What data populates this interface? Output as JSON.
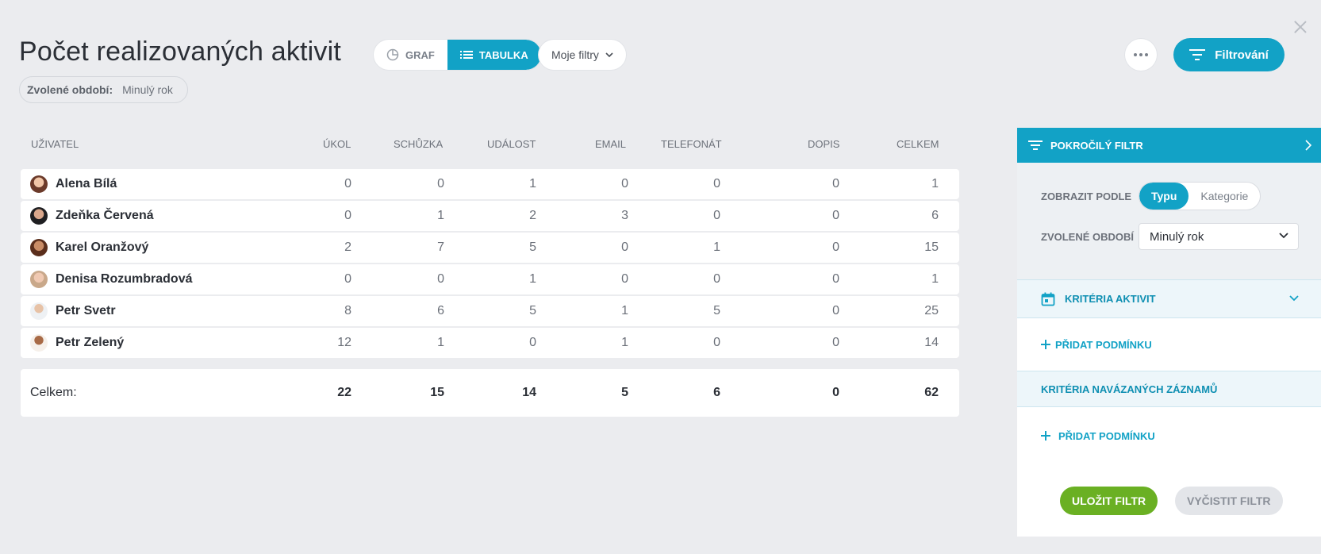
{
  "header": {
    "title": "Počet realizovaných aktivit",
    "view_graph_label": "GRAF",
    "view_table_label": "TABULKA",
    "my_filters_label": "Moje filtry",
    "period_key": "Zvolené období:",
    "period_value": "Minulý rok",
    "filter_button_label": "Filtrování"
  },
  "table": {
    "columns": [
      "UŽIVATEL",
      "ÚKOL",
      "SCHŮZKA",
      "UDÁLOST",
      "EMAIL",
      "TELEFONÁT",
      "DOPIS",
      "CELKEM"
    ],
    "rows": [
      {
        "user": "Alena Bílá",
        "values": [
          "0",
          "0",
          "1",
          "0",
          "0",
          "0",
          "1"
        ]
      },
      {
        "user": "Zdeňka Červená",
        "values": [
          "0",
          "1",
          "2",
          "3",
          "0",
          "0",
          "6"
        ]
      },
      {
        "user": "Karel Oranžový",
        "values": [
          "2",
          "7",
          "5",
          "0",
          "1",
          "0",
          "15"
        ]
      },
      {
        "user": "Denisa Rozumbradová",
        "values": [
          "0",
          "0",
          "1",
          "0",
          "0",
          "0",
          "1"
        ]
      },
      {
        "user": "Petr Svetr",
        "values": [
          "8",
          "6",
          "5",
          "1",
          "5",
          "0",
          "25"
        ]
      },
      {
        "user": "Petr Zelený",
        "values": [
          "12",
          "1",
          "0",
          "1",
          "0",
          "0",
          "14"
        ]
      }
    ],
    "total": {
      "label": "Celkem:",
      "values": [
        "22",
        "15",
        "14",
        "5",
        "6",
        "0",
        "62"
      ]
    }
  },
  "panel": {
    "title": "POKROČILÝ FILTR",
    "show_by_label": "ZOBRAZIT PODLE",
    "show_by_options": [
      "Typu",
      "Kategorie"
    ],
    "show_by_selected": "Typu",
    "period_label": "ZVOLENÉ OBDOBÍ",
    "period_value": "Minulý rok",
    "activity_criteria_label": "KRITÉRIA AKTIVIT",
    "add_condition_label": "PŘIDAT PODMÍNKU",
    "linked_criteria_label": "KRITÉRIA NAVÁZANÝCH ZÁZNAMŮ",
    "add_condition_label_2": "PŘIDAT PODMÍNKU",
    "save_label": "ULOŽIT FILTR",
    "clear_label": "VYČISTIT FILTR"
  },
  "colors": {
    "accent": "#12a2c6",
    "save": "#6ab023",
    "background": "#ebecef"
  }
}
